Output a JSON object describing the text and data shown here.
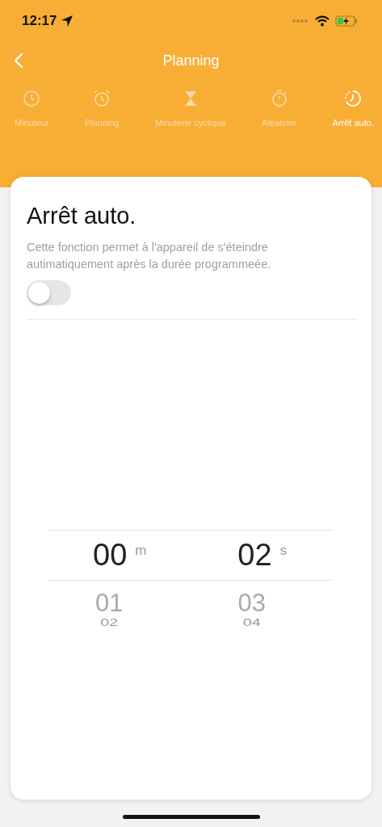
{
  "status_bar": {
    "time": "12:17"
  },
  "nav": {
    "title": "Planning"
  },
  "tabs": [
    {
      "label": "Minuteur",
      "kind": "clock",
      "selected": false
    },
    {
      "label": "Planning",
      "kind": "alarm",
      "selected": false
    },
    {
      "label": "Minuterie cyclique",
      "kind": "hourglass",
      "selected": false
    },
    {
      "label": "Aléatoire",
      "kind": "stopwatch",
      "selected": false
    },
    {
      "label": "Arrêt auto.",
      "kind": "autooff",
      "selected": true
    }
  ],
  "card": {
    "title": "Arrêt auto.",
    "description": "Cette fonction permet à l'appareil de s'éteindre autimatiquement après la durée programmeée.",
    "toggle": {
      "on": false
    }
  },
  "picker": [
    {
      "selected": "00",
      "unit": "m",
      "below": [
        "01",
        "02"
      ]
    },
    {
      "selected": "02",
      "unit": "s",
      "below": [
        "03",
        "04"
      ]
    }
  ]
}
